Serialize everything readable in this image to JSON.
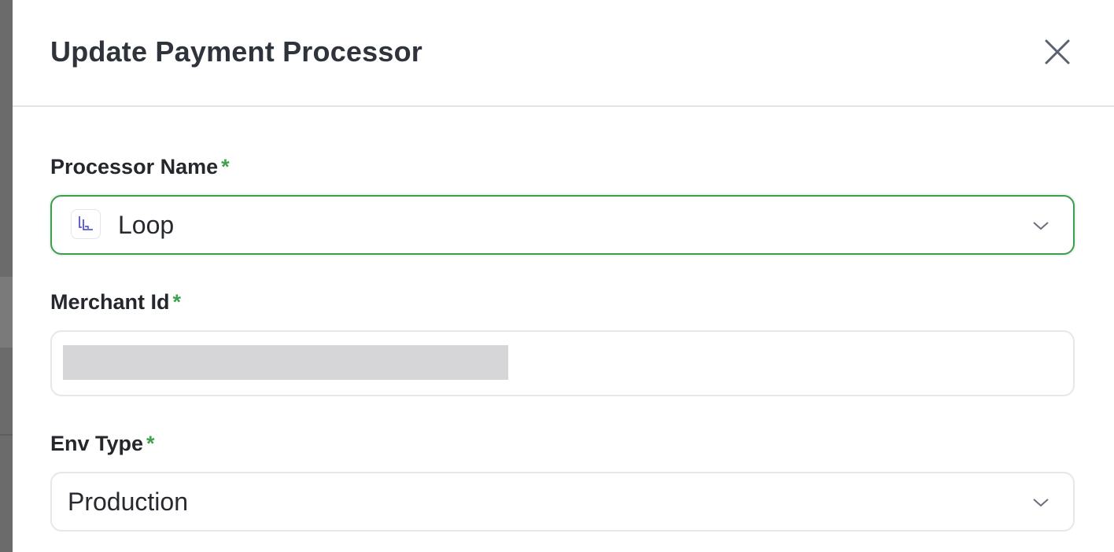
{
  "dialog": {
    "title": "Update Payment Processor"
  },
  "fields": {
    "processor": {
      "label": "Processor Name",
      "required_mark": "*",
      "value": "Loop",
      "logo_icon": "loop-logo-icon"
    },
    "merchant": {
      "label": "Merchant Id",
      "required_mark": "*"
    },
    "env": {
      "label": "Env Type",
      "required_mark": "*",
      "value": "Production"
    }
  },
  "colors": {
    "accent_green": "#3f9c4c",
    "title_text": "#2f343c",
    "border": "#e6e7ea"
  }
}
